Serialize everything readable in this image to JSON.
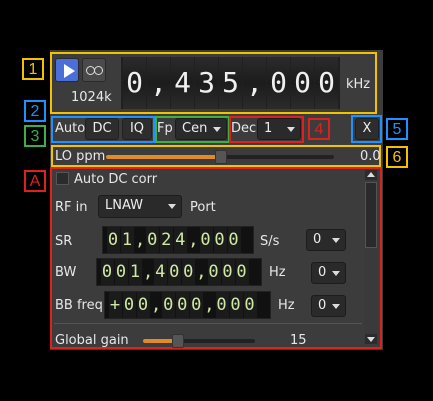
{
  "callouts": {
    "c1": {
      "text": "1",
      "color": "#f2c200"
    },
    "c2": {
      "text": "2",
      "color": "#1e90ff"
    },
    "c3": {
      "text": "3",
      "color": "#3cb043"
    },
    "c4": {
      "text": "4",
      "color": "#e02020"
    },
    "c5": {
      "text": "5",
      "color": "#1e90ff"
    },
    "c6": {
      "text": "6",
      "color": "#f2c200"
    },
    "cA": {
      "text": "A",
      "color": "#e02020"
    }
  },
  "top": {
    "play_icon": "play-icon",
    "record_icon": "record-icon",
    "sample_rate": "1024k",
    "center_freq_digits": [
      "0",
      ",",
      "4",
      "3",
      "5",
      ",",
      "0",
      "0",
      "0"
    ],
    "freq_unit": "kHz"
  },
  "row2": {
    "auto_label": "Auto",
    "dc_label": "DC",
    "iq_label": "IQ",
    "fp_label": "Fp",
    "fp_value": "Cen",
    "dec_label": "Dec",
    "dec_value": "1",
    "close_label": "X"
  },
  "lo": {
    "label": "LO ppm",
    "value": "0.0",
    "slider_fraction": 0.5
  },
  "settings": {
    "auto_dc_label": "Auto DC corr",
    "auto_dc_checked": false,
    "rf_in_label": "RF in",
    "rf_in_value": "LNAW",
    "port_label": "Port",
    "sr_label": "SR",
    "sr_digits": "01,024,000",
    "sr_unit": "S/s",
    "sr_combo": "0",
    "bw_label": "BW",
    "bw_digits": "001,400,000",
    "bw_unit": "Hz",
    "bw_combo": "0",
    "bb_label": "BB freq",
    "bb_digits": "+00,000,000",
    "bb_unit": "Hz",
    "bb_combo": "0",
    "gain_label": "Global gain",
    "gain_value": "15",
    "gain_fraction": 0.3
  }
}
